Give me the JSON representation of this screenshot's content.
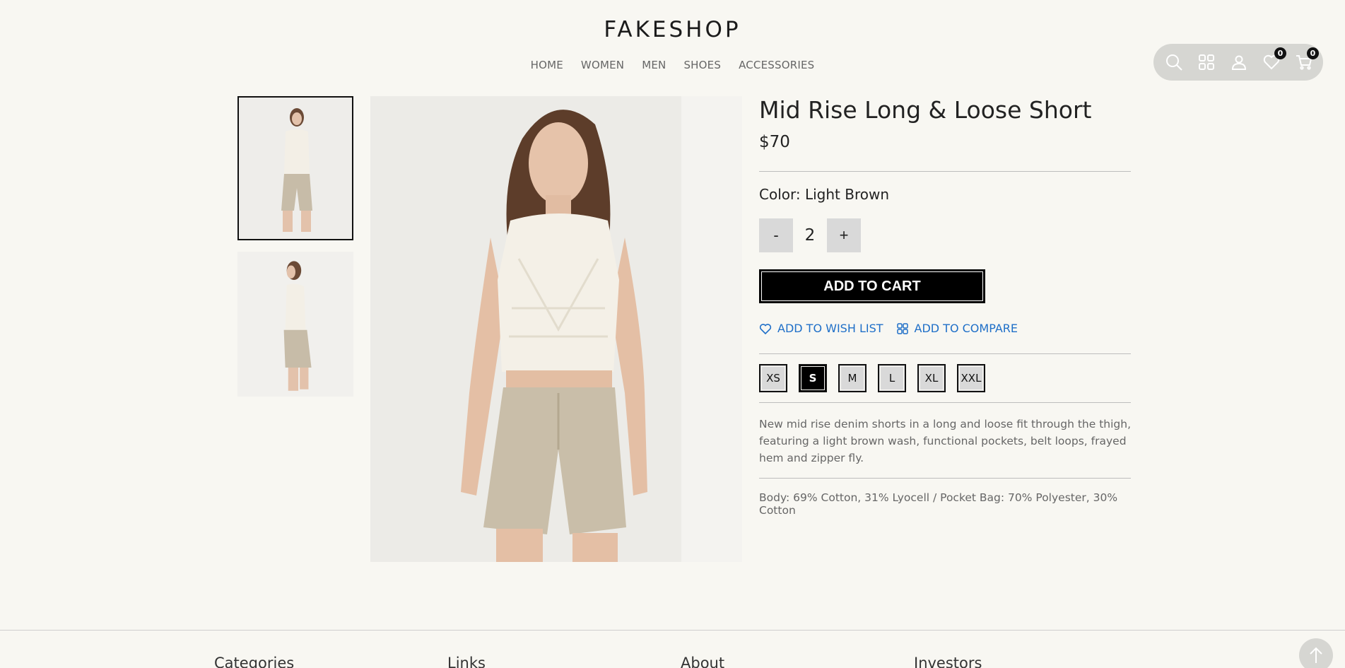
{
  "brand": "FAKESHOP",
  "nav": [
    "HOME",
    "WOMEN",
    "MEN",
    "SHOES",
    "ACCESSORIES"
  ],
  "header_icons": {
    "wishlist_count": "0",
    "cart_count": "0"
  },
  "product": {
    "title": "Mid Rise Long & Loose Short",
    "price": "$70",
    "color_label": "Color: Light Brown",
    "quantity": "2",
    "qty_minus": "-",
    "qty_plus": "+",
    "add_to_cart": "ADD TO CART",
    "add_to_wishlist": "ADD TO WISH LIST",
    "add_to_compare": "ADD TO COMPARE",
    "sizes": [
      "XS",
      "S",
      "M",
      "L",
      "XL",
      "XXL"
    ],
    "selected_size": "S",
    "description": "New mid rise denim shorts in a long and loose fit through the thigh, featuring a light brown wash, functional pockets, belt loops, frayed hem and zipper fly.",
    "material": "Body: 69% Cotton, 31% Lyocell / Pocket Bag: 70% Polyester, 30% Cotton"
  },
  "footer": [
    "Categories",
    "Links",
    "About",
    "Investors"
  ],
  "colors": {
    "background": "#f8f7f2",
    "link": "#1f6fc8",
    "button": "#000000"
  }
}
